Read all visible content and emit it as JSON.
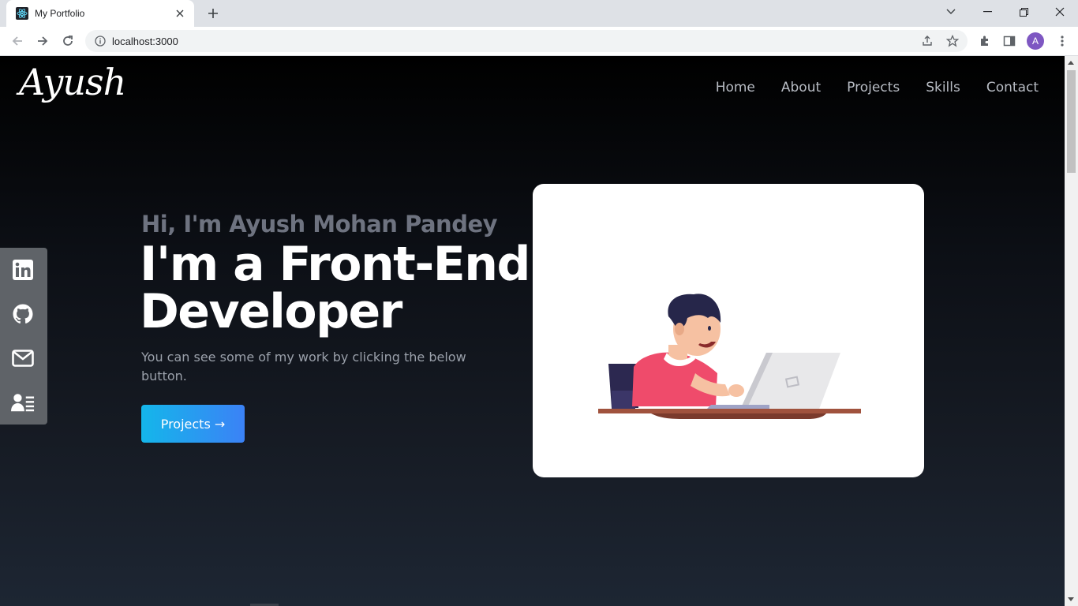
{
  "browser": {
    "tab_title": "My Portfolio",
    "url": "localhost:3000",
    "avatar_letter": "A"
  },
  "site": {
    "logo": "Ayush",
    "nav": [
      "Home",
      "About",
      "Projects",
      "Skills",
      "Contact"
    ]
  },
  "hero": {
    "greeting": "Hi, I'm Ayush Mohan Pandey",
    "title": "I'm a Front-End Developer",
    "description": "You can see some of my work by clicking the below button.",
    "cta_label": "Projects →"
  },
  "social": [
    "linkedin-icon",
    "github-icon",
    "mail-icon",
    "resume-icon"
  ],
  "colors": {
    "accent_start": "#14b6ea",
    "accent_end": "#3b82f6",
    "sidebar": "#5f6368"
  }
}
